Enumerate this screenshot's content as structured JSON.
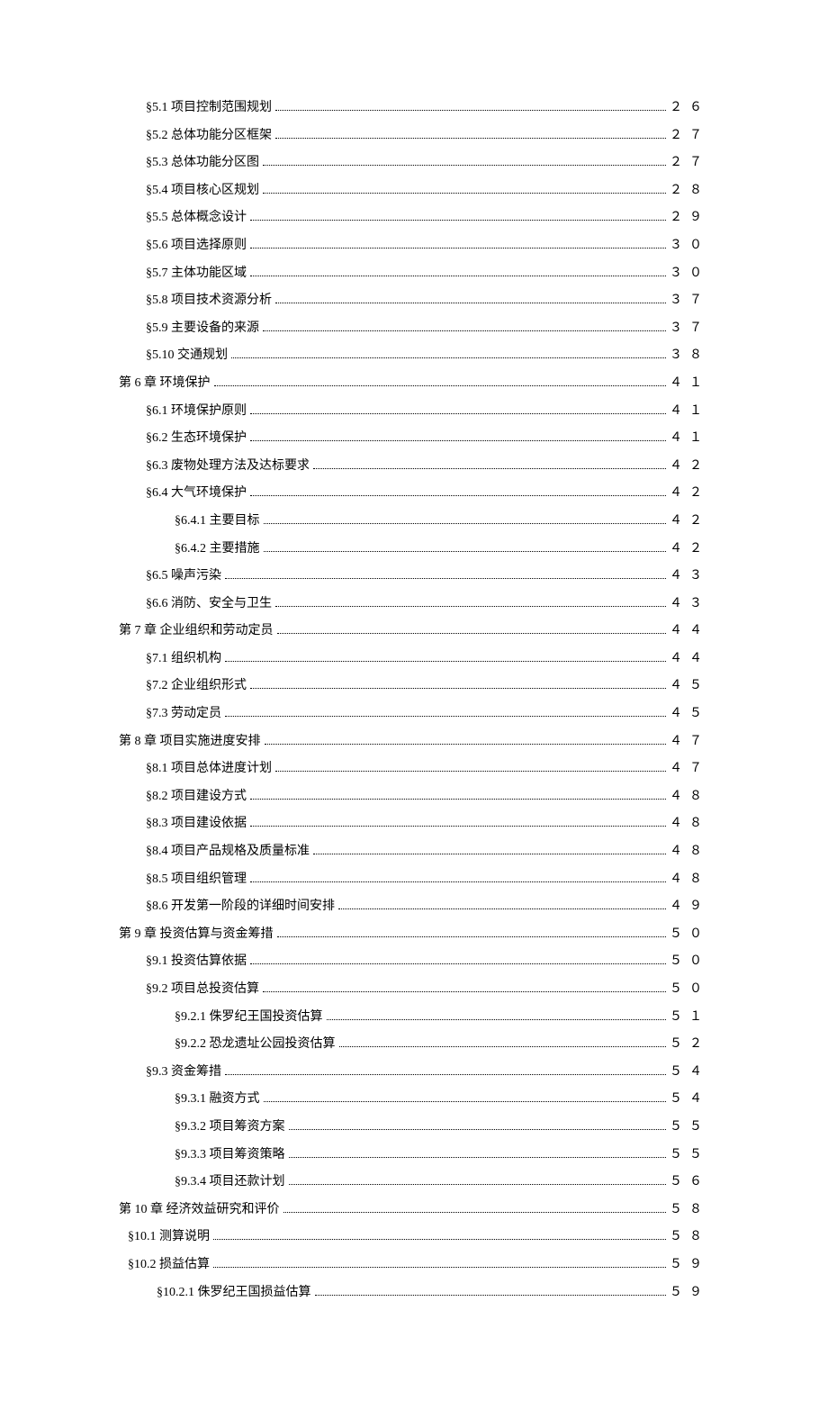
{
  "toc": [
    {
      "label": "§5.1 项目控制范围规划",
      "page": "２６",
      "level": "section"
    },
    {
      "label": "§5.2 总体功能分区框架",
      "page": "２７",
      "level": "section"
    },
    {
      "label": "§5.3 总体功能分区图",
      "page": "２７",
      "level": "section"
    },
    {
      "label": "§5.4 项目核心区规划",
      "page": "２８",
      "level": "section"
    },
    {
      "label": "§5.5 总体概念设计",
      "page": "２９",
      "level": "section"
    },
    {
      "label": "§5.6 项目选择原则",
      "page": "３０",
      "level": "section"
    },
    {
      "label": "§5.7 主体功能区域",
      "page": "３０",
      "level": "section"
    },
    {
      "label": "§5.8 项目技术资源分析",
      "page": "３７",
      "level": "section"
    },
    {
      "label": "§5.9 主要设备的来源",
      "page": "３７",
      "level": "section"
    },
    {
      "label": "§5.10 交通规划",
      "page": "３８",
      "level": "section"
    },
    {
      "label": "第 6 章 环境保护",
      "page": "４１",
      "level": "chapter"
    },
    {
      "label": "§6.1 环境保护原则",
      "page": "４１",
      "level": "section"
    },
    {
      "label": "§6.2 生态环境保护",
      "page": "４１",
      "level": "section"
    },
    {
      "label": "§6.3 废物处理方法及达标要求",
      "page": "４２",
      "level": "section"
    },
    {
      "label": "§6.4 大气环境保护",
      "page": "４２",
      "level": "section"
    },
    {
      "label": "§6.4.1 主要目标",
      "page": "４２",
      "level": "subsection"
    },
    {
      "label": "§6.4.2 主要措施",
      "page": "４２",
      "level": "subsection"
    },
    {
      "label": "§6.5 噪声污染",
      "page": "４３",
      "level": "section"
    },
    {
      "label": "§6.6 消防、安全与卫生",
      "page": "４３",
      "level": "section"
    },
    {
      "label": "第 7 章 企业组织和劳动定员",
      "page": "４４",
      "level": "chapter"
    },
    {
      "label": "§7.1 组织机构",
      "page": "４４",
      "level": "section"
    },
    {
      "label": "§7.2 企业组织形式",
      "page": "４５",
      "level": "section"
    },
    {
      "label": "§7.3 劳动定员",
      "page": "４５",
      "level": "section"
    },
    {
      "label": "第 8 章 项目实施进度安排",
      "page": "４７",
      "level": "chapter"
    },
    {
      "label": "§8.1 项目总体进度计划",
      "page": "４７",
      "level": "section"
    },
    {
      "label": "§8.2 项目建设方式",
      "page": "４８",
      "level": "section"
    },
    {
      "label": "§8.3 项目建设依据",
      "page": "４８",
      "level": "section"
    },
    {
      "label": "§8.4 项目产品规格及质量标准",
      "page": "４８",
      "level": "section"
    },
    {
      "label": "§8.5 项目组织管理",
      "page": "４８",
      "level": "section"
    },
    {
      "label": "§8.6 开发第一阶段的详细时间安排",
      "page": "４９",
      "level": "section"
    },
    {
      "label": "第 9 章 投资估算与资金筹措",
      "page": "５０",
      "level": "chapter"
    },
    {
      "label": "§9.1 投资估算依据",
      "page": "５０",
      "level": "section"
    },
    {
      "label": "§9.2 项目总投资估算",
      "page": "５０",
      "level": "section"
    },
    {
      "label": "§9.2.1 侏罗纪王国投资估算",
      "page": "５１",
      "level": "subsection"
    },
    {
      "label": "§9.2.2 恐龙遗址公园投资估算",
      "page": "５２",
      "level": "subsection"
    },
    {
      "label": "§9.3 资金筹措",
      "page": "５４",
      "level": "section"
    },
    {
      "label": "§9.3.1 融资方式",
      "page": "５４",
      "level": "subsection"
    },
    {
      "label": "§9.3.2 项目筹资方案",
      "page": "５５",
      "level": "subsection"
    },
    {
      "label": "§9.3.3 项目筹资策略",
      "page": "５５",
      "level": "subsection"
    },
    {
      "label": "§9.3.4 项目还款计划",
      "page": "５６",
      "level": "subsection"
    },
    {
      "label": "第 10 章 经济效益研究和评价",
      "page": "５８",
      "level": "chapter"
    },
    {
      "label": "§10.1 测算说明",
      "page": "５８",
      "level": "10"
    },
    {
      "label": "§10.2 损益估算",
      "page": "５９",
      "level": "10"
    },
    {
      "label": "§10.2.1 侏罗纪王国损益估算",
      "page": "５９",
      "level": "10-sub"
    }
  ]
}
